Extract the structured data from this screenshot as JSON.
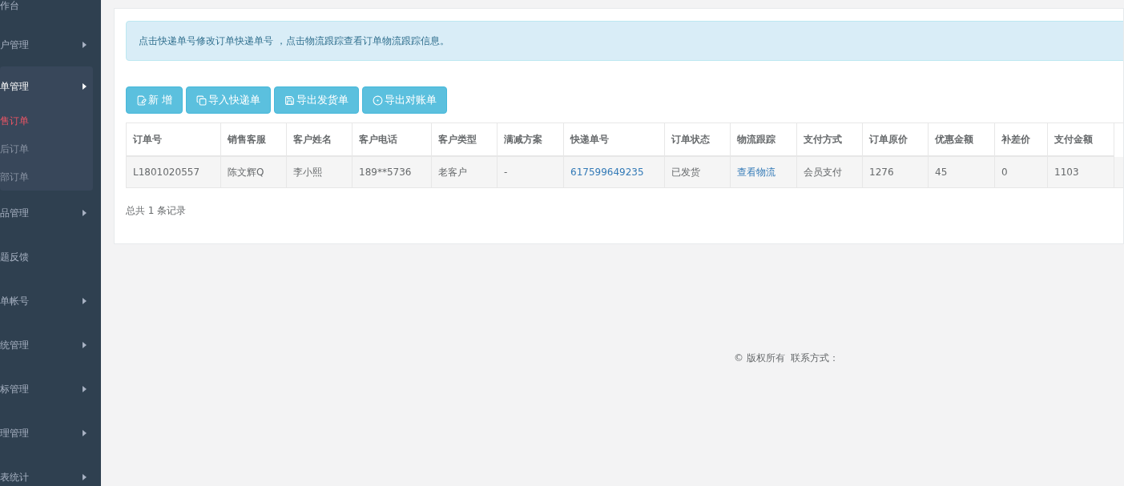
{
  "sidebar": {
    "items": [
      {
        "label": "作台",
        "arrow": false,
        "expanded": false
      },
      {
        "label": "户管理",
        "arrow": true,
        "expanded": false
      },
      {
        "label": "单管理",
        "arrow": true,
        "expanded": true,
        "children": [
          {
            "label": "售订单",
            "selected": true
          },
          {
            "label": "后订单",
            "selected": false
          },
          {
            "label": "部订单",
            "selected": false
          }
        ]
      },
      {
        "label": "品管理",
        "arrow": true,
        "expanded": false
      },
      {
        "label": "题反馈",
        "arrow": false,
        "expanded": false
      },
      {
        "label": "单帐号",
        "arrow": true,
        "expanded": false
      },
      {
        "label": "统管理",
        "arrow": true,
        "expanded": false
      },
      {
        "label": "标管理",
        "arrow": true,
        "expanded": false
      },
      {
        "label": "理管理",
        "arrow": true,
        "expanded": false
      },
      {
        "label": "表统计",
        "arrow": true,
        "expanded": false
      }
    ]
  },
  "alert": "点击快递单号修改订单快递单号 ，点击物流跟踪查看订单物流跟踪信息。",
  "toolbar": [
    {
      "kind": "add",
      "label": "新 增"
    },
    {
      "kind": "import",
      "label": "导入快递单"
    },
    {
      "kind": "save",
      "label": "导出发货单"
    },
    {
      "kind": "export",
      "label": "导出对账单"
    }
  ],
  "table": {
    "columns": [
      "订单号",
      "销售客服",
      "客户姓名",
      "客户电话",
      "客户类型",
      "满减方案",
      "快递单号",
      "订单状态",
      "物流跟踪",
      "支付方式",
      "订单原价",
      "优惠金额",
      "补差价",
      "支付金额"
    ],
    "rows": [
      [
        {
          "text": "L1801020557",
          "link": false
        },
        {
          "text": "陈文辉Q",
          "link": false
        },
        {
          "text": "李小熙",
          "link": false
        },
        {
          "text": "189**5736",
          "link": false
        },
        {
          "text": "老客户",
          "link": false
        },
        {
          "text": "-",
          "link": false
        },
        {
          "text": "617599649235",
          "link": true
        },
        {
          "text": "已发货",
          "link": false
        },
        {
          "text": "查看物流",
          "link": true
        },
        {
          "text": "会员支付",
          "link": false
        },
        {
          "text": "1276",
          "link": false
        },
        {
          "text": "45",
          "link": false
        },
        {
          "text": "0",
          "link": false
        },
        {
          "text": "1103",
          "link": false
        }
      ]
    ]
  },
  "record_count": "总共 1 条记录",
  "footer": "© 版权所有  联系方式："
}
